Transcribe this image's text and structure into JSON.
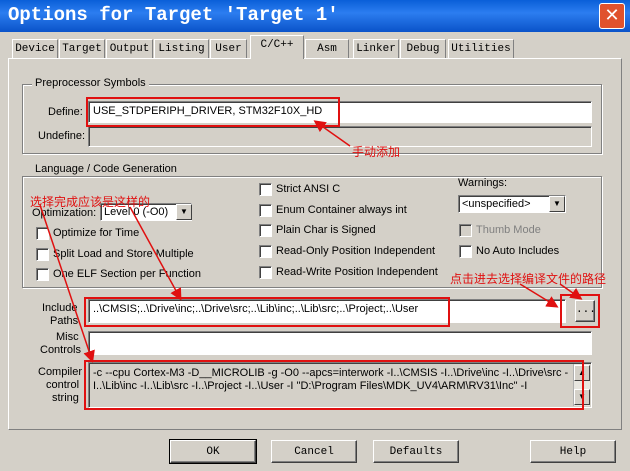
{
  "window": {
    "title": "Options for Target 'Target 1'",
    "close_glyph": "✕"
  },
  "tabs": [
    "Device",
    "Target",
    "Output",
    "Listing",
    "User",
    "C/C++",
    "Asm",
    "Linker",
    "Debug",
    "Utilities"
  ],
  "preprocessor": {
    "group_label": "Preprocessor Symbols",
    "define_label": "Define:",
    "define_value": "USE_STDPERIPH_DRIVER, STM32F10X_HD",
    "undefine_label": "Undefine:",
    "undefine_value": ""
  },
  "language": {
    "group_label": "Language / Code Generation",
    "optimization_label": "Optimization:",
    "optimization_value": "Level 0 (-O0)",
    "left_checks": [
      "Optimize for Time",
      "Split Load and Store Multiple",
      "One ELF Section per Function"
    ],
    "mid_checks": [
      "Strict ANSI C",
      "Enum Container always int",
      "Plain Char is Signed",
      "Read-Only Position Independent",
      "Read-Write Position Independent"
    ],
    "warnings_label": "Warnings:",
    "warnings_value": "<unspecified>",
    "thumb_mode": "Thumb Mode",
    "no_auto_includes": "No Auto Includes"
  },
  "include": {
    "label_line1": "Include",
    "label_line2": "Paths",
    "value": "..\\CMSIS;..\\Drive\\inc;..\\Drive\\src;..\\Lib\\inc;..\\Lib\\src;..\\Project;..\\User",
    "browse": "..."
  },
  "misc": {
    "label_line1": "Misc",
    "label_line2": "Controls",
    "value": ""
  },
  "compiler": {
    "label_line1": "Compiler",
    "label_line2": "control",
    "label_line3": "string",
    "line1": "-c --cpu Cortex-M3 -D__MICROLIB -g -O0 --apcs=interwork -I..\\CMSIS -I..\\Drive\\inc -I..\\Drive\\src -",
    "line2": "I..\\Lib\\inc -I..\\Lib\\src -I..\\Project -I..\\User -I \"D:\\Program Files\\MDK_UV4\\ARM\\RV31\\Inc\" -I"
  },
  "buttons": {
    "ok": "OK",
    "cancel": "Cancel",
    "defaults": "Defaults",
    "help": "Help"
  },
  "annotations": {
    "manual_add": "手动添加",
    "should_be": "选择完成应该是这样的",
    "click_select": "点击进去选择编译文件的路径"
  },
  "colors": {
    "annotation": "#e01010",
    "titlebar": "#0a5fd8",
    "face": "#d4d0c8"
  }
}
